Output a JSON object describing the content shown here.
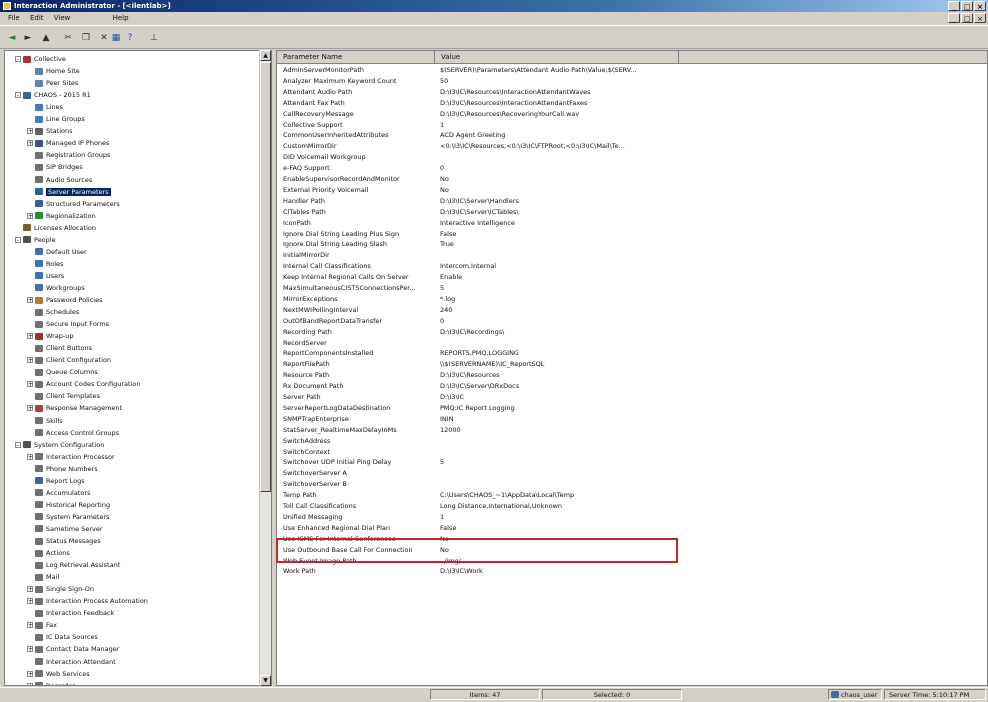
{
  "window": {
    "title": "Interaction Administrator - [<ilentlab>]"
  },
  "menu": {
    "items": [
      "File",
      "Edit",
      "View",
      "Help"
    ]
  },
  "tree": {
    "items": [
      {
        "label": "Collective",
        "level": 0,
        "exp": "-",
        "icon": "collective-icon",
        "color": "#b03030"
      },
      {
        "label": "Home Site",
        "level": 1,
        "exp": "",
        "icon": "site-icon",
        "color": "#6080b0"
      },
      {
        "label": "Peer Sites",
        "level": 1,
        "exp": "",
        "icon": "site-icon",
        "color": "#6080b0"
      },
      {
        "label": "CHAOS - 2015 R1",
        "level": 0,
        "exp": "-",
        "icon": "server-icon",
        "color": "#3a5f9f"
      },
      {
        "label": "Lines",
        "level": 1,
        "exp": "",
        "icon": "lines-icon",
        "color": "#4a78c0"
      },
      {
        "label": "Line Groups",
        "level": 1,
        "exp": "",
        "icon": "line-groups-icon",
        "color": "#4a78c0"
      },
      {
        "label": "Stations",
        "level": 1,
        "exp": "+",
        "icon": "stations-icon",
        "color": "#606060"
      },
      {
        "label": "Managed IP Phones",
        "level": 1,
        "exp": "+",
        "icon": "phone-icon",
        "color": "#405080"
      },
      {
        "label": "Registration Groups",
        "level": 1,
        "exp": "",
        "icon": "registration-icon",
        "color": "#707070"
      },
      {
        "label": "SIP Bridges",
        "level": 1,
        "exp": "",
        "icon": "sip-bridge-icon",
        "color": "#707070"
      },
      {
        "label": "Audio Sources",
        "level": 1,
        "exp": "",
        "icon": "audio-icon",
        "color": "#707070"
      },
      {
        "label": "Server Parameters",
        "level": 1,
        "exp": "",
        "icon": "server-parameters-icon",
        "color": "#3060a0",
        "selected": true
      },
      {
        "label": "Structured Parameters",
        "level": 1,
        "exp": "",
        "icon": "structured-parameters-icon",
        "color": "#3060a0"
      },
      {
        "label": "Regionalization",
        "level": 1,
        "exp": "+",
        "icon": "globe-icon",
        "color": "#2a8a3a"
      },
      {
        "label": "Licenses Allocation",
        "level": 0,
        "exp": "",
        "icon": "license-icon",
        "color": "#806020"
      },
      {
        "label": "People",
        "level": 0,
        "exp": "-",
        "icon": "people-icon",
        "color": "#505050"
      },
      {
        "label": "Default User",
        "level": 1,
        "exp": "",
        "icon": "user-icon",
        "color": "#4070b0"
      },
      {
        "label": "Roles",
        "level": 1,
        "exp": "",
        "icon": "roles-icon",
        "color": "#4070b0"
      },
      {
        "label": "Users",
        "level": 1,
        "exp": "",
        "icon": "users-icon",
        "color": "#4070b0"
      },
      {
        "label": "Workgroups",
        "level": 1,
        "exp": "",
        "icon": "workgroups-icon",
        "color": "#4070b0"
      },
      {
        "label": "Password Policies",
        "level": 1,
        "exp": "+",
        "icon": "password-icon",
        "color": "#b08030"
      },
      {
        "label": "Schedules",
        "level": 1,
        "exp": "",
        "icon": "schedule-icon",
        "color": "#707070"
      },
      {
        "label": "Secure Input Forms",
        "level": 1,
        "exp": "",
        "icon": "form-icon",
        "color": "#707070"
      },
      {
        "label": "Wrap-up",
        "level": 1,
        "exp": "+",
        "icon": "wrapup-icon",
        "color": "#a03030"
      },
      {
        "label": "Client Buttons",
        "level": 1,
        "exp": "",
        "icon": "button-icon",
        "color": "#707070"
      },
      {
        "label": "Client Configuration",
        "level": 1,
        "exp": "+",
        "icon": "client-config-icon",
        "color": "#707070"
      },
      {
        "label": "Queue Columns",
        "level": 1,
        "exp": "",
        "icon": "queue-icon",
        "color": "#707070"
      },
      {
        "label": "Account Codes Configuration",
        "level": 1,
        "exp": "+",
        "icon": "account-codes-icon",
        "color": "#707070"
      },
      {
        "label": "Client Templates",
        "level": 1,
        "exp": "",
        "icon": "template-icon",
        "color": "#707070"
      },
      {
        "label": "Response Management",
        "level": 1,
        "exp": "+",
        "icon": "response-icon",
        "color": "#b04040"
      },
      {
        "label": "Skills",
        "level": 1,
        "exp": "",
        "icon": "skills-icon",
        "color": "#707070"
      },
      {
        "label": "Access Control Groups",
        "level": 1,
        "exp": "",
        "icon": "access-icon",
        "color": "#707070"
      },
      {
        "label": "System Configuration",
        "level": 0,
        "exp": "-",
        "icon": "system-config-icon",
        "color": "#505050"
      },
      {
        "label": "Interaction Processor",
        "level": 1,
        "exp": "+",
        "icon": "processor-icon",
        "color": "#707070"
      },
      {
        "label": "Phone Numbers",
        "level": 1,
        "exp": "",
        "icon": "phone-numbers-icon",
        "color": "#707070"
      },
      {
        "label": "Report Logs",
        "level": 1,
        "exp": "",
        "icon": "report-icon",
        "color": "#4060a0"
      },
      {
        "label": "Accumulators",
        "level": 1,
        "exp": "",
        "icon": "accumulator-icon",
        "color": "#707070"
      },
      {
        "label": "Historical Reporting",
        "level": 1,
        "exp": "",
        "icon": "historical-icon",
        "color": "#707070"
      },
      {
        "label": "System Parameters",
        "level": 1,
        "exp": "",
        "icon": "system-parameters-icon",
        "color": "#707070"
      },
      {
        "label": "Sametime Server",
        "level": 1,
        "exp": "",
        "icon": "sametime-icon",
        "color": "#707070"
      },
      {
        "label": "Status Messages",
        "level": 1,
        "exp": "",
        "icon": "status-icon",
        "color": "#707070"
      },
      {
        "label": "Actions",
        "level": 1,
        "exp": "",
        "icon": "actions-icon",
        "color": "#707070"
      },
      {
        "label": "Log Retrieval Assistant",
        "level": 1,
        "exp": "",
        "icon": "log-icon",
        "color": "#707070"
      },
      {
        "label": "Mail",
        "level": 1,
        "exp": "",
        "icon": "mail-icon",
        "color": "#707070"
      },
      {
        "label": "Single Sign-On",
        "level": 1,
        "exp": "+",
        "icon": "sso-icon",
        "color": "#707070"
      },
      {
        "label": "Interaction Process Automation",
        "level": 1,
        "exp": "+",
        "icon": "automation-icon",
        "color": "#707070"
      },
      {
        "label": "Interaction Feedback",
        "level": 1,
        "exp": "",
        "icon": "feedback-icon",
        "color": "#707070"
      },
      {
        "label": "Fax",
        "level": 1,
        "exp": "+",
        "icon": "fax-icon",
        "color": "#707070"
      },
      {
        "label": "IC Data Sources",
        "level": 1,
        "exp": "",
        "icon": "data-sources-icon",
        "color": "#707070"
      },
      {
        "label": "Contact Data Manager",
        "level": 1,
        "exp": "+",
        "icon": "contact-icon",
        "color": "#707070"
      },
      {
        "label": "Interaction Attendant",
        "level": 1,
        "exp": "",
        "icon": "attendant-icon",
        "color": "#707070"
      },
      {
        "label": "Web Services",
        "level": 1,
        "exp": "+",
        "icon": "web-services-icon",
        "color": "#707070"
      },
      {
        "label": "Recorder",
        "level": 1,
        "exp": "+",
        "icon": "recorder-icon",
        "color": "#707070"
      }
    ]
  },
  "list": {
    "columns": [
      "Parameter Name",
      "Value"
    ],
    "rows": [
      {
        "name": "AdminServerMonitorPath",
        "value": "$(SERVER)\\Parameters\\Attendant Audio Path\\Value;$(SERV..."
      },
      {
        "name": "Analyzer Maximum Keyword Count",
        "value": "50"
      },
      {
        "name": "Attendant Audio Path",
        "value": "D:\\I3\\IC\\Resources\\InteractionAttendantWaves"
      },
      {
        "name": "Attendant Fax Path",
        "value": "D:\\I3\\IC\\Resources\\InteractionAttendantFaxes"
      },
      {
        "name": "CallRecoveryMessage",
        "value": "D:\\I3\\IC\\Resources\\RecoveringYourCall.wav"
      },
      {
        "name": "Collective Support",
        "value": "1"
      },
      {
        "name": "CommonUserInheritedAttributes",
        "value": "ACD Agent Greeting"
      },
      {
        "name": "CustomMirrorDir",
        "value": "<0:\\I3\\IC\\Resources;<0:\\I3\\IC\\FTPRoot;<0:\\I3\\IC\\Mail\\Te..."
      },
      {
        "name": "DID Voicemail Workgroup",
        "value": ""
      },
      {
        "name": "e-FAQ Support",
        "value": "0"
      },
      {
        "name": "EnableSupervisorRecordAndMonitor",
        "value": "No"
      },
      {
        "name": "External Priority Voicemail",
        "value": "No"
      },
      {
        "name": "Handler Path",
        "value": "D:\\I3\\IC\\Server\\Handlers"
      },
      {
        "name": "ClTables Path",
        "value": "D:\\I3\\IC\\Server\\ICTables\\"
      },
      {
        "name": "IconPath",
        "value": "Interactive Intelligence"
      },
      {
        "name": "Ignore Dial String Leading Plus Sign",
        "value": "False"
      },
      {
        "name": "Ignore Dial String Leading Slash",
        "value": "True"
      },
      {
        "name": "InitialMirrorDir",
        "value": ""
      },
      {
        "name": "Internal Call Classifications",
        "value": "Intercom,Internal"
      },
      {
        "name": "Keep Internal Regional Calls On Server",
        "value": "Enable"
      },
      {
        "name": "MaxSimultaneousCISTSConnectionsPer...",
        "value": "5"
      },
      {
        "name": "MirrorExceptions",
        "value": "*.log"
      },
      {
        "name": "NextMWIPollingInterval",
        "value": "240"
      },
      {
        "name": "OutOfBandReportDataTransfer",
        "value": "0"
      },
      {
        "name": "Recording Path",
        "value": "D:\\I3\\IC\\Recordings\\"
      },
      {
        "name": "RecordServer",
        "value": ""
      },
      {
        "name": "ReportComponentsInstalled",
        "value": "REPORTS,PMQ,LOGGING"
      },
      {
        "name": "ReportFilePath",
        "value": "\\\\$(SERVERNAME)\\IC_ReportSQL"
      },
      {
        "name": "Resource Path",
        "value": "D:\\I3\\IC\\Resources"
      },
      {
        "name": "Rx Document Path",
        "value": "D:\\I3\\IC\\Server\\DRxDocs"
      },
      {
        "name": "Server Path",
        "value": "D:\\I3\\IC"
      },
      {
        "name": "ServerReportLogDataDestination",
        "value": "PMQ:IC Report Logging"
      },
      {
        "name": "SNMPTrapEnterprise",
        "value": "ININ"
      },
      {
        "name": "StatServer_RealtimeMaxDelayInMs",
        "value": "12000"
      },
      {
        "name": "SwitchAddress",
        "value": ""
      },
      {
        "name": "SwitchContext",
        "value": ""
      },
      {
        "name": "Switchover UDP Initial Ping Delay",
        "value": "5"
      },
      {
        "name": "SwitchoverServer A",
        "value": ""
      },
      {
        "name": "SwitchoverServer B",
        "value": ""
      },
      {
        "name": "Temp Path",
        "value": "C:\\Users\\CHAOS_~1\\AppData\\Local\\Temp"
      },
      {
        "name": "Toll Call Classifications",
        "value": "Long Distance,International,Unknown"
      },
      {
        "name": "Unified Messaging",
        "value": "1"
      },
      {
        "name": "Use Enhanced Regional Dial Plan",
        "value": "False"
      },
      {
        "name": "Use ICMS For Internal Conferences",
        "value": "No"
      },
      {
        "name": "Use Outbound Base Call For Connection",
        "value": "No"
      },
      {
        "name": "Web Event Image Path",
        "value": "../img/"
      },
      {
        "name": "Work Path",
        "value": "D:\\I3\\IC\\Work"
      }
    ]
  },
  "status": {
    "items_text": "Items: 47",
    "selected_text": "Selected: 0",
    "user": "chaos_user",
    "server_time": "Server Time: 5:10:17 PM"
  }
}
